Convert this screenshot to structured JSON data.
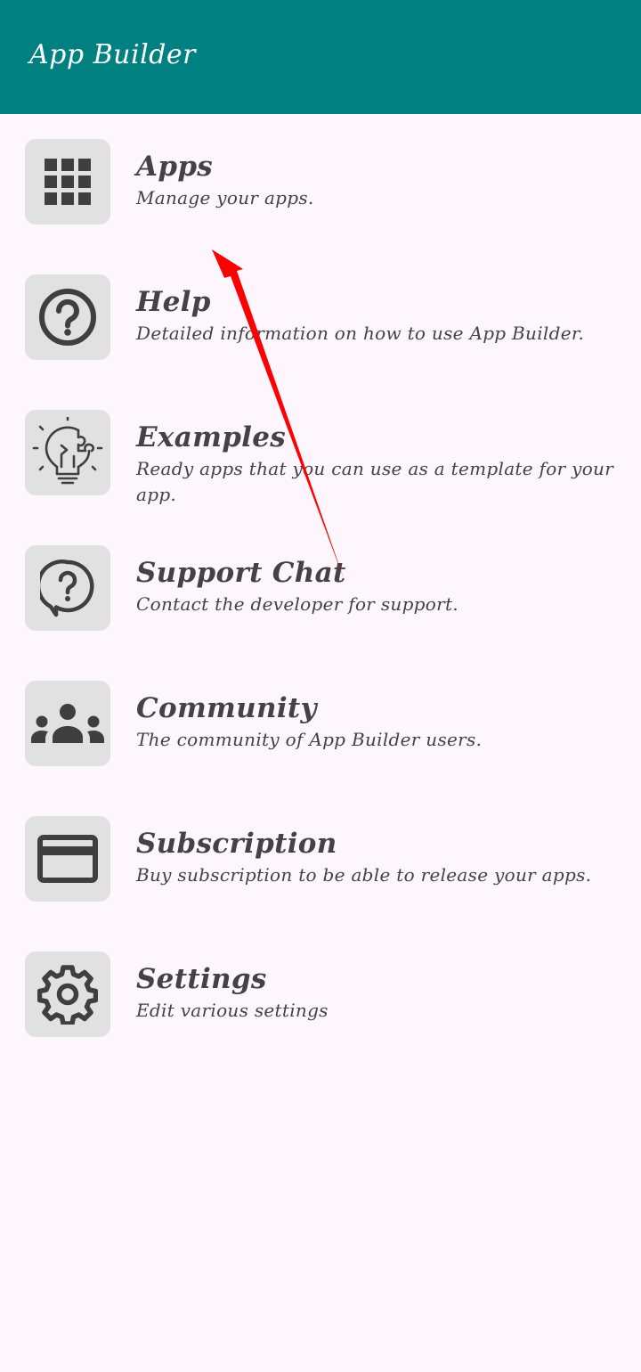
{
  "appbar": {
    "title": "App Builder",
    "color": "#008080"
  },
  "menu": {
    "items": [
      {
        "title": "Apps",
        "subtitle": "Manage your apps.",
        "icon": "grid-icon"
      },
      {
        "title": "Help",
        "subtitle": "Detailed information on how to use App Builder.",
        "icon": "help-circle-icon"
      },
      {
        "title": "Examples",
        "subtitle": "Ready apps that you can use as a template for your app.",
        "icon": "lightbulb-puzzle-icon"
      },
      {
        "title": "Support Chat",
        "subtitle": "Contact the developer for support.",
        "icon": "chat-question-icon"
      },
      {
        "title": "Community",
        "subtitle": "The community of App Builder users.",
        "icon": "group-icon"
      },
      {
        "title": "Subscription",
        "subtitle": "Buy subscription to be able to release your apps.",
        "icon": "credit-card-icon"
      },
      {
        "title": "Settings",
        "subtitle": "Edit various settings",
        "icon": "gear-icon"
      }
    ]
  },
  "annotation": {
    "arrow_color": "#ff0000"
  }
}
